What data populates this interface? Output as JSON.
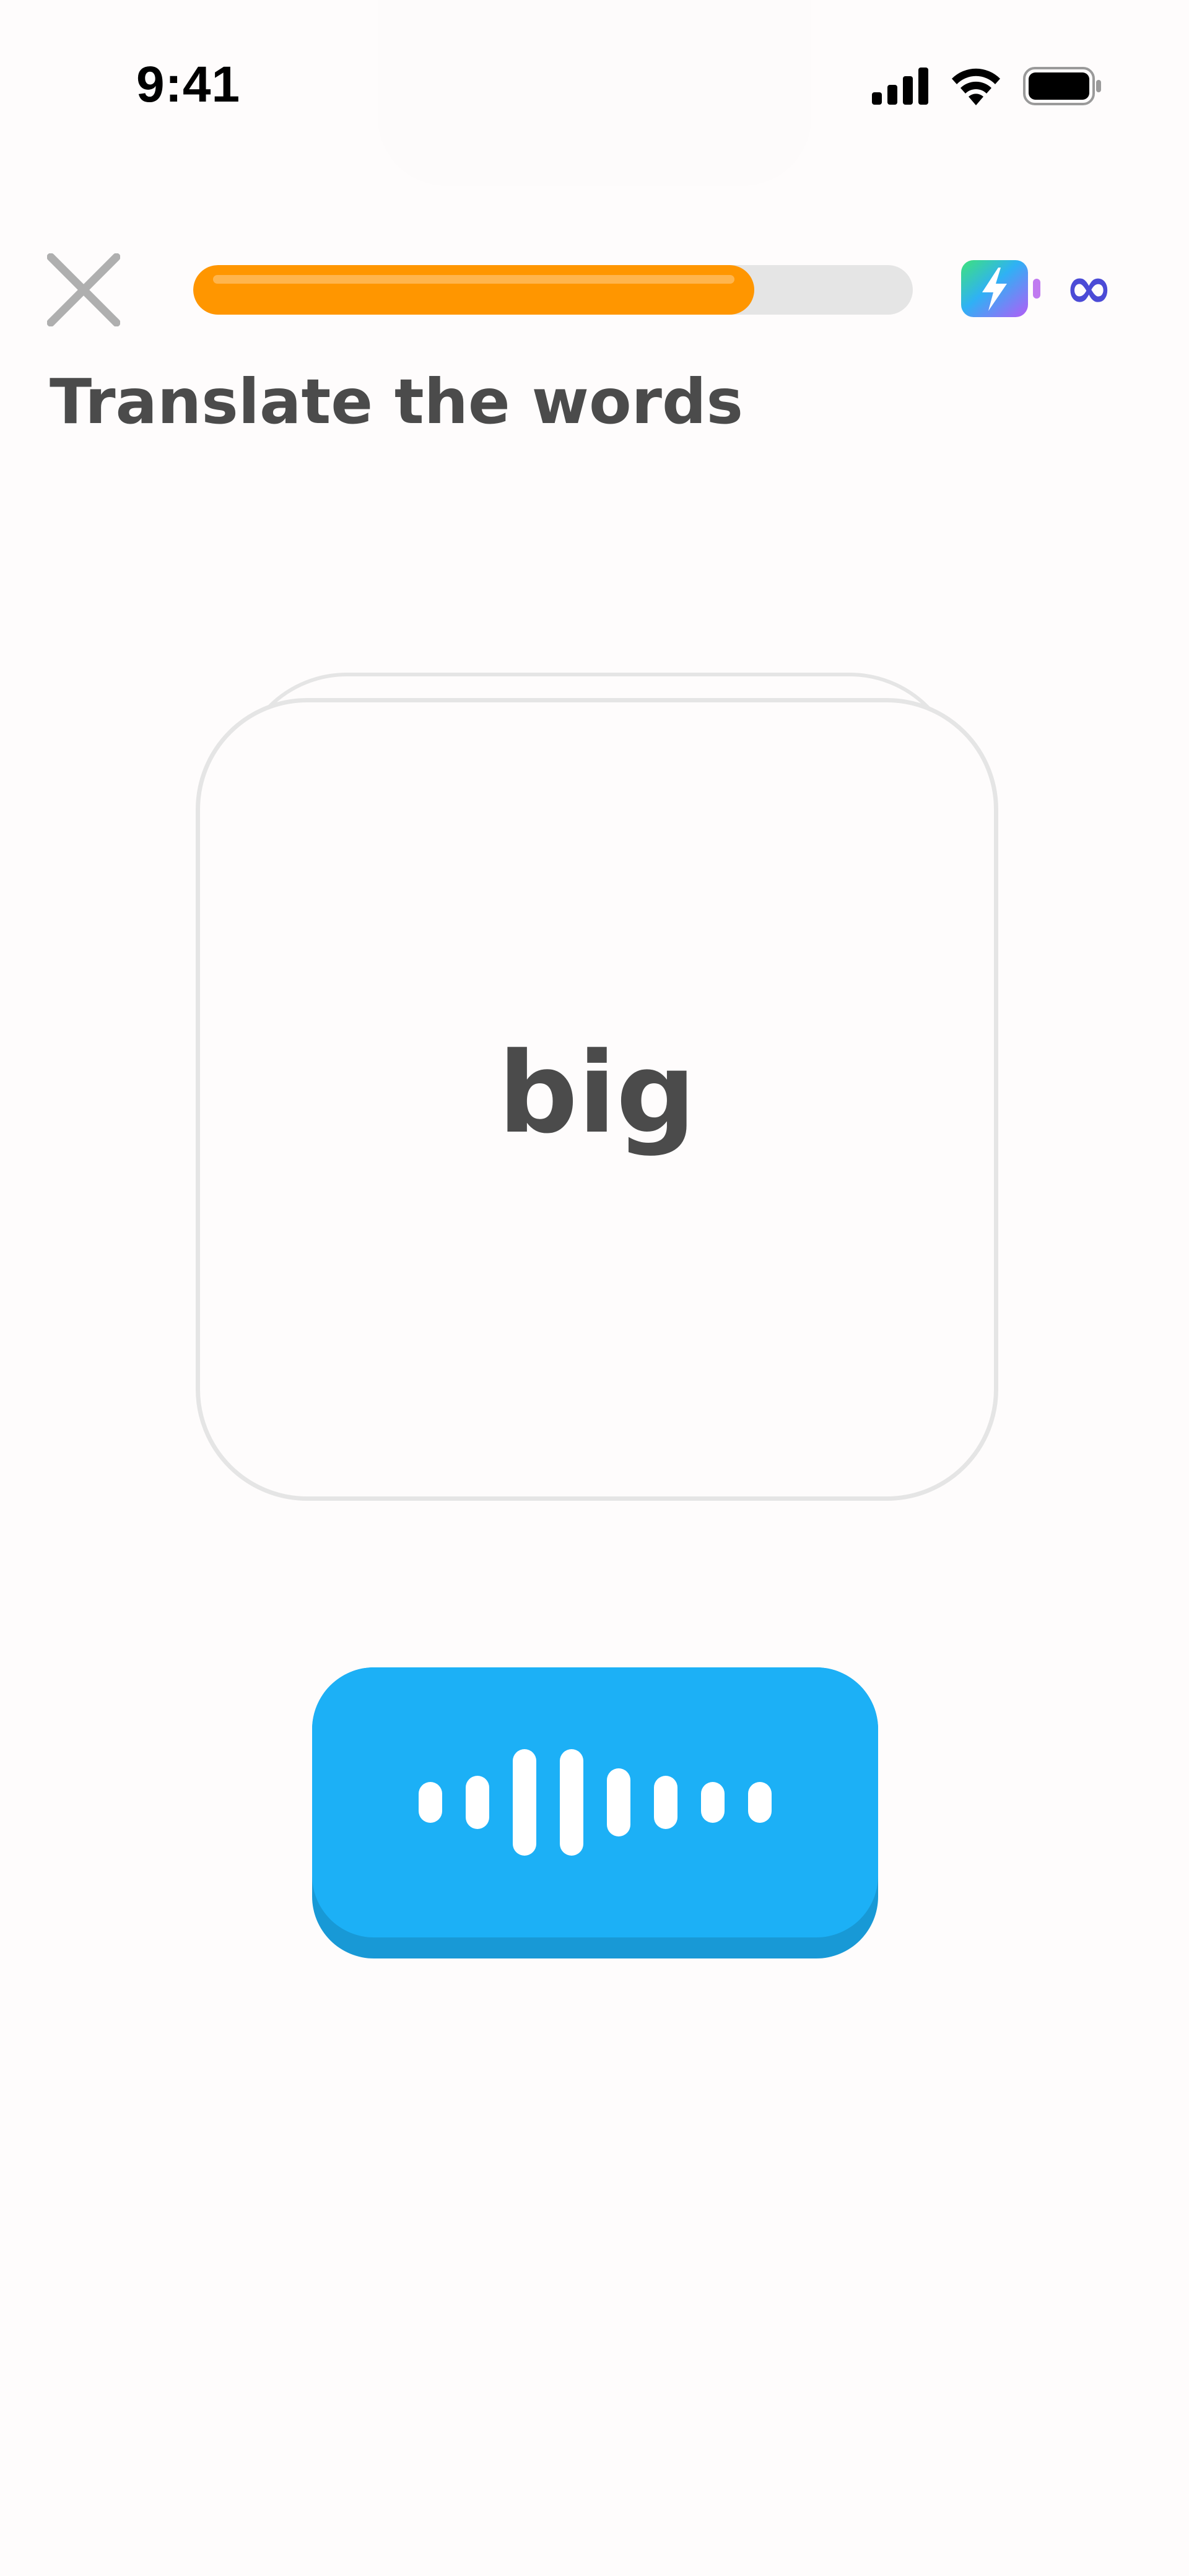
{
  "status_bar": {
    "time": "9:41",
    "icons": [
      "cellular-signal-icon",
      "wifi-icon",
      "battery-icon"
    ]
  },
  "top_bar": {
    "close_icon": "close-icon",
    "progress_fraction": 0.78,
    "energy_icon": "energy-battery-icon",
    "energy_count": "∞"
  },
  "prompt": {
    "title": "Translate the words"
  },
  "card": {
    "word": "big"
  },
  "audio_button": {
    "icon": "sound-wave-icon"
  },
  "colors": {
    "progress": "#ff9600",
    "progress_track": "#e5e5e5",
    "energy": "#4b4bd6",
    "audio_button": "#1cb0f6",
    "text": "#4b4b4b"
  }
}
